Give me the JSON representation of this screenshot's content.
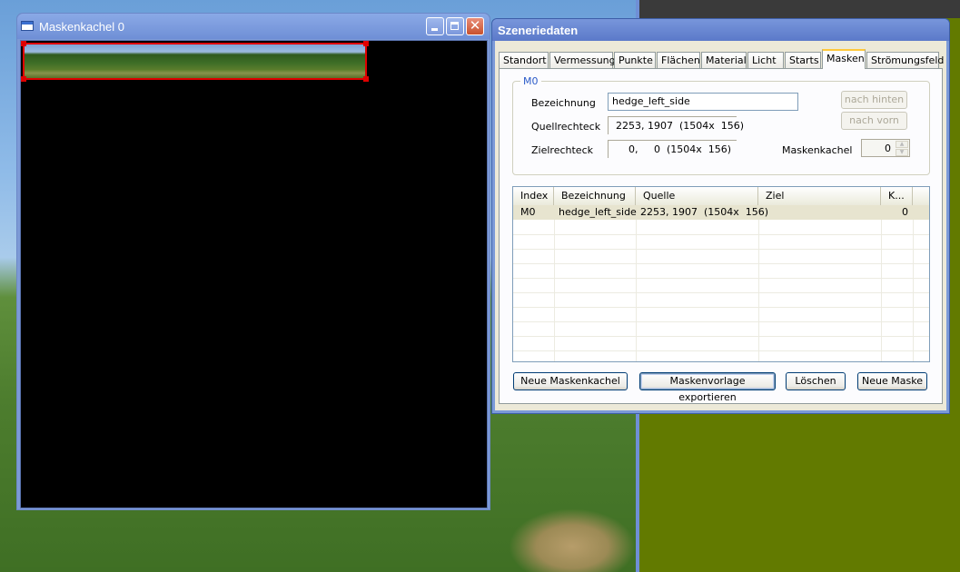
{
  "mask_tile_window": {
    "title": "Maskenkachel 0",
    "close_glyph": "✕"
  },
  "scenery_dialog": {
    "title": "Szeneriedaten",
    "tabs": [
      {
        "label": "Standort",
        "active": false
      },
      {
        "label": "Vermessung",
        "active": false
      },
      {
        "label": "Punkte",
        "active": false
      },
      {
        "label": "Flächen",
        "active": false
      },
      {
        "label": "Material",
        "active": false
      },
      {
        "label": "Licht",
        "active": false
      },
      {
        "label": "Starts",
        "active": false
      },
      {
        "label": "Masken",
        "active": true
      },
      {
        "label": "Strömungsfeld",
        "active": false
      }
    ],
    "group": {
      "title": "M0",
      "bezeichnung_label": "Bezeichnung",
      "bezeichnung_value": "hedge_left_side",
      "quellrechteck_label": "Quellrechteck",
      "quellrechteck_value": "2253, 1907  (1504x  156)",
      "zielrechteck_label": "Zielrechteck",
      "zielrechteck_value": "    0,     0  (1504x  156)",
      "maskenkachel_label": "Maskenkachel",
      "maskenkachel_value": "0",
      "nach_hinten": "nach hinten",
      "nach_vorn": "nach vorn"
    },
    "table": {
      "columns": [
        "Index",
        "Bezeichnung",
        "Quelle",
        "Ziel",
        "K..."
      ],
      "rows": [
        {
          "index": "M0",
          "bezeichnung": "hedge_left_side",
          "quelle": "2253, 1907  (1504x  156)",
          "ziel": "",
          "k": "0"
        }
      ]
    },
    "buttons": {
      "neue_maskenkachel": "Neue Maskenkachel",
      "maskenvorlage_exportieren": "Maskenvorlage exportieren",
      "loeschen": "Löschen",
      "neue_maske": "Neue Maske"
    }
  }
}
